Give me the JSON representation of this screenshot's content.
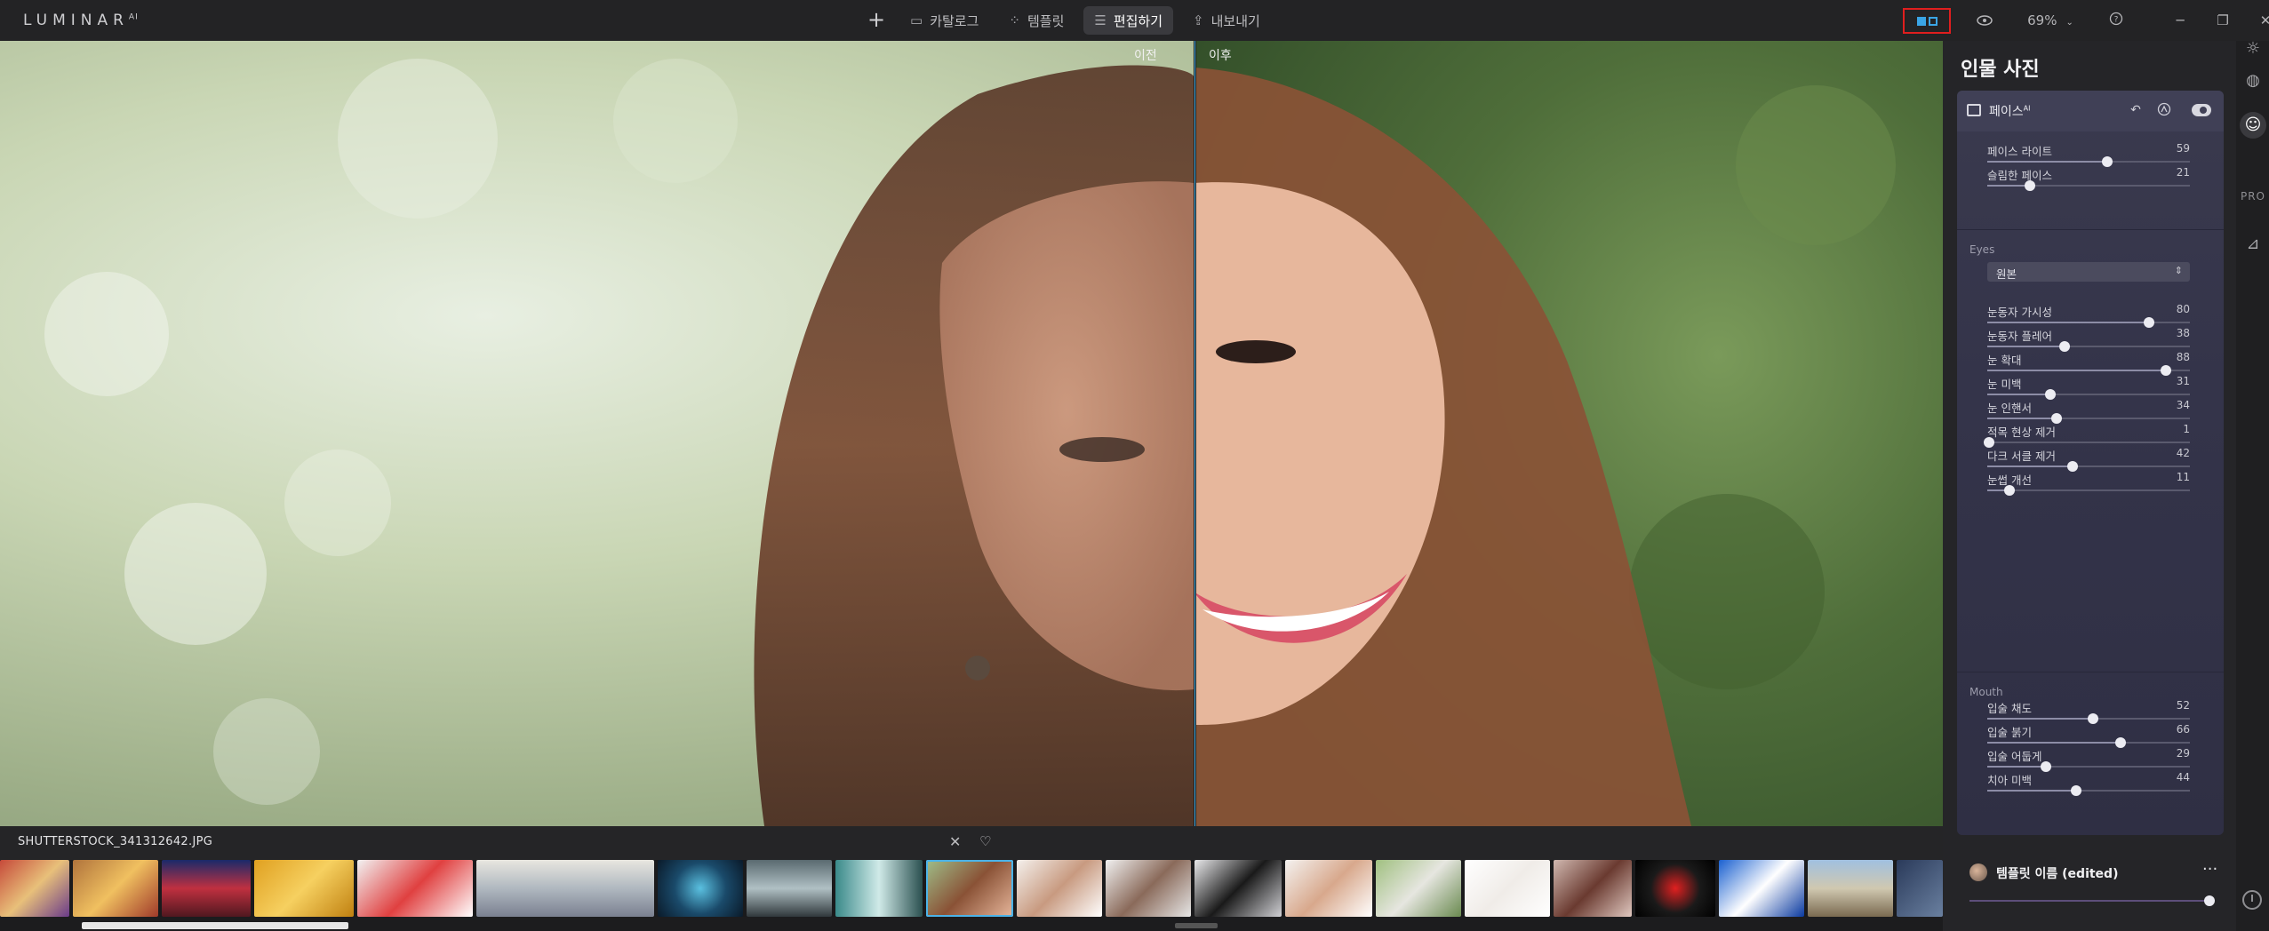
{
  "app": {
    "logo": "LUMINAR",
    "logo_sup": "AI"
  },
  "nav": {
    "add_label": "+",
    "tabs": [
      {
        "label": "카탈로그",
        "icon": "folder-icon",
        "active": false
      },
      {
        "label": "템플릿",
        "icon": "sparkle-icon",
        "active": false
      },
      {
        "label": "편집하기",
        "icon": "sliders-icon",
        "active": true
      },
      {
        "label": "내보내기",
        "icon": "share-icon",
        "active": false
      }
    ]
  },
  "topright": {
    "compare_icon": "before-after-icon",
    "view_icon": "eye-icon",
    "zoom": "69%",
    "help_icon": "help-icon",
    "minimize": "─",
    "restore": "❐",
    "close": "✕"
  },
  "canvas": {
    "before_label": "이전",
    "after_label": "이후"
  },
  "filmstrip": {
    "file_name": "SHUTTERSTOCK_341312642.JPG",
    "close_icon": "close-icon",
    "heart_icon": "heart-icon"
  },
  "panel": {
    "title": "인물 사진",
    "module": {
      "name": "페이스",
      "name_sup": "AI",
      "undo_icon": "undo-icon",
      "mask_icon": "brush-mask-icon",
      "visibility_icon": "toggle-icon"
    },
    "face_sliders": [
      {
        "label": "페이스 라이트",
        "value": 59
      },
      {
        "label": "슬림한 페이스",
        "value": 21
      }
    ],
    "eyes_label": "Eyes",
    "eyes_dropdown": "원본",
    "eyes_sliders": [
      {
        "label": "눈동자 가시성",
        "value": 80
      },
      {
        "label": "눈동자 플레어",
        "value": 38
      },
      {
        "label": "눈 확대",
        "value": 88
      },
      {
        "label": "눈 미백",
        "value": 31
      },
      {
        "label": "눈 인핸서",
        "value": 34
      },
      {
        "label": "적목 현상 제거",
        "value": 1
      },
      {
        "label": "다크 서클 제거",
        "value": 42
      },
      {
        "label": "눈썹 개선",
        "value": 11
      }
    ],
    "mouth_label": "Mouth",
    "mouth_sliders": [
      {
        "label": "입술 채도",
        "value": 52
      },
      {
        "label": "입술 붉기",
        "value": 66
      },
      {
        "label": "입술 어둡게",
        "value": 29
      },
      {
        "label": "치아 미백",
        "value": 44
      }
    ],
    "template": {
      "name": "템플릿 이름 (edited)",
      "more": "···",
      "amount": 100
    }
  },
  "tools": {
    "items": [
      "sun-icon",
      "palette-icon",
      "face-icon"
    ],
    "pro_label": "PRO",
    "canvas_icon": "canvas-icon",
    "history_icon": "clock-icon"
  },
  "colors": {
    "accent": "#4bb3e8",
    "highlight": "#e01e1e",
    "panel_bg": "#252528",
    "module_bg": "#3a3a4e"
  }
}
